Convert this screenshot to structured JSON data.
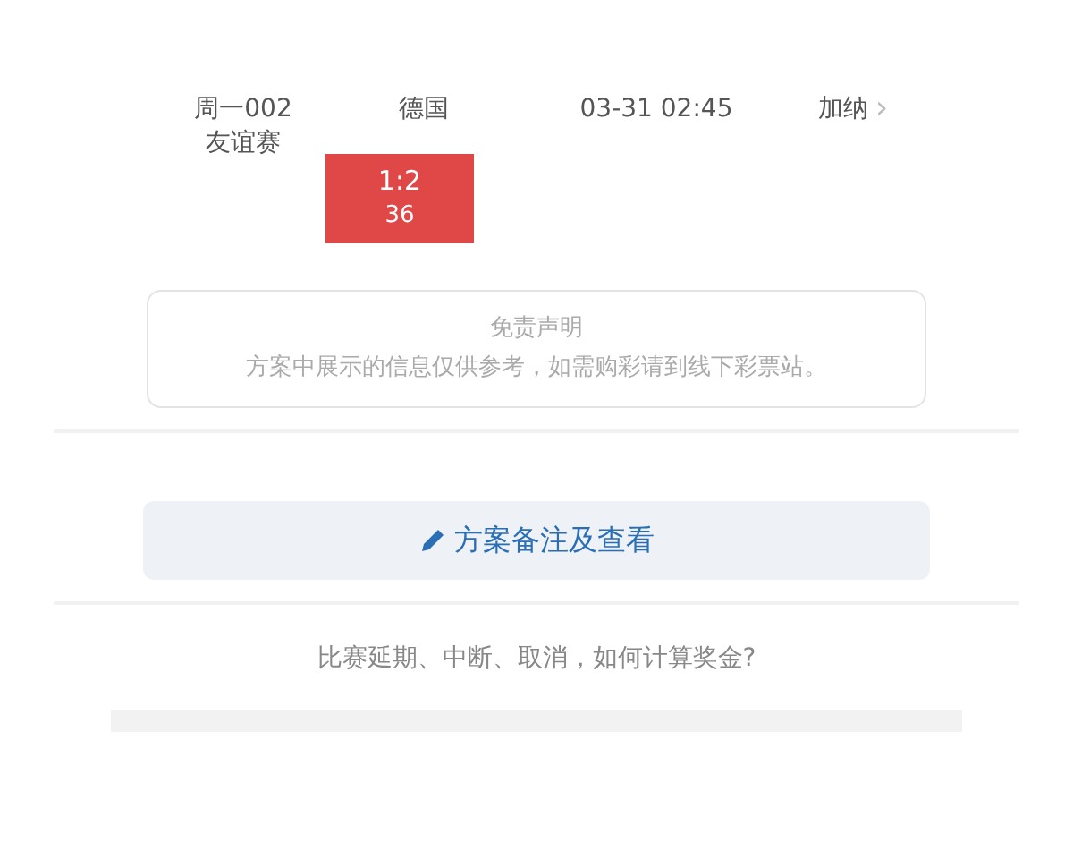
{
  "match": {
    "code": "周一002",
    "league": "友谊赛",
    "home": "德国",
    "time": "03-31 02:45",
    "away": "加纳",
    "away_arrow": "›",
    "result": {
      "score": "1:2",
      "value": "36",
      "selected": true
    }
  },
  "disclaimer": {
    "title": "免责声明",
    "text": "方案中展示的信息仅供参考，如需购彩请到线下彩票站。"
  },
  "notes_button": {
    "label": "方案备注及查看"
  },
  "faq_link": "比赛延期、中断、取消，如何计算奖金?"
}
